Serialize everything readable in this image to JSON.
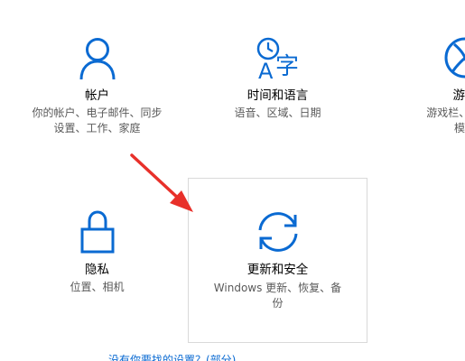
{
  "tiles": [
    {
      "id": "accounts",
      "title": "帐户",
      "desc_lines": [
        "你的帐户、电子邮件、同步",
        "设置、工作、家庭"
      ],
      "icon": "person-icon"
    },
    {
      "id": "time-language",
      "title": "时间和语言",
      "desc_lines": [
        "语音、区域、日期"
      ],
      "icon": "time-language-icon"
    },
    {
      "id": "gaming",
      "title": "游戏",
      "desc_lines": [
        "游戏栏、DVR、",
        "模式"
      ],
      "icon": "xbox-icon"
    },
    {
      "id": "privacy",
      "title": "隐私",
      "desc_lines": [
        "位置、相机"
      ],
      "icon": "lock-icon"
    },
    {
      "id": "update-security",
      "title": "更新和安全",
      "desc_lines": [
        "Windows 更新、恢复、备",
        "份"
      ],
      "icon": "sync-icon"
    }
  ],
  "bottom_link": {
    "text": "没有你要找的设置？(部分)"
  },
  "annotation": {
    "arrow_color": "#e8302a"
  },
  "colors": {
    "accent": "#0a6ad2",
    "title": "#000000",
    "desc": "#5a5a5a"
  }
}
